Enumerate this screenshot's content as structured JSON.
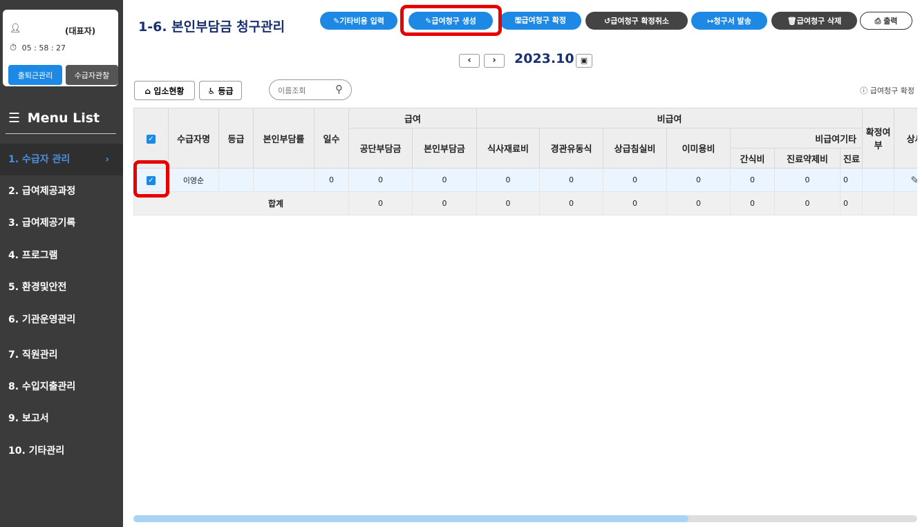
{
  "user": {
    "name": "",
    "role": "(대표자)",
    "time": "05 : 58 : 27"
  },
  "sidebar_buttons": {
    "attend": "출퇴근관리",
    "observe": "수급자관찰"
  },
  "menu": {
    "title": "Menu List",
    "items": [
      {
        "label": "1. 수급자 관리",
        "active": true
      },
      {
        "label": "2. 급여제공과정"
      },
      {
        "label": "3. 급여제공기록"
      },
      {
        "label": "4. 프로그램"
      },
      {
        "label": "5. 환경및안전"
      },
      {
        "label": "6. 기관운영관리"
      },
      {
        "label": "7. 직원관리"
      },
      {
        "label": "8. 수입지출관리"
      },
      {
        "label": "9. 보고서"
      },
      {
        "label": "10. 기타관리"
      }
    ]
  },
  "header": {
    "title": "1-6. 본인부담금 청구관리",
    "buttons": {
      "other_cost": "✎기타비용 입력",
      "create": "✎급여청구 생성",
      "confirm": "🖫급여청구 확정",
      "cancel_confirm": "↺급여청구 확정취소",
      "send": "↦청구서 발송",
      "delete": "🗑급여청구 삭제",
      "print": "⎙ 출력"
    }
  },
  "period": "2023.10",
  "filters": {
    "admission": "입소현황",
    "grade": "등급",
    "search_placeholder": "이름조회",
    "help": "급여청구 확정"
  },
  "table": {
    "group_headers": {
      "benefit": "급여",
      "non_benefit": "비급여",
      "non_benefit_other": "비급여기타"
    },
    "headers": {
      "name": "수급자명",
      "grade": "등급",
      "rate": "본인부담률",
      "days": "일수",
      "public": "공단부담금",
      "self": "본인부담금",
      "food": "식사재료비",
      "tube": "경관유동식",
      "room": "상급침실비",
      "beauty": "이미용비",
      "snack": "간식비",
      "medicine": "진료약제비",
      "cut": "진료",
      "confirm": "확정여부",
      "detail": "상세"
    },
    "rows": [
      {
        "name": "이영순",
        "grade": "",
        "rate": "",
        "days": "0",
        "public": "0",
        "self": "0",
        "food": "0",
        "tube": "0",
        "room": "0",
        "beauty": "0",
        "snack": "0",
        "medicine": "0",
        "cut": "0",
        "confirm": ""
      }
    ],
    "total": {
      "label": "합계",
      "public": "0",
      "self": "0",
      "food": "0",
      "tube": "0",
      "room": "0",
      "beauty": "0",
      "snack": "0",
      "medicine": "0",
      "cut": "0"
    }
  },
  "colors": {
    "accent": "#1e88e5",
    "sidebar": "#3b3b3b",
    "highlight": "#e60000",
    "title": "#1a2f6e"
  }
}
